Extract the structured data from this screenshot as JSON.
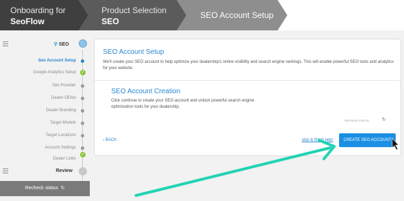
{
  "header": {
    "step1": {
      "sub": "Onboarding for",
      "main": "SeoFlow"
    },
    "step2": {
      "sub": "Product Selection",
      "main": "SEO"
    },
    "step3": {
      "title": "SEO Account Setup"
    }
  },
  "sidebar": {
    "section": "SEO",
    "items": [
      {
        "label": "Seo Account Setup",
        "state": "active"
      },
      {
        "label": "Google Analytics Setup",
        "state": "complete"
      },
      {
        "label": "Site Provider",
        "state": "pending"
      },
      {
        "label": "Dealer OEMs",
        "state": "pending"
      },
      {
        "label": "Dealer Branding",
        "state": "pending"
      },
      {
        "label": "Target Models",
        "state": "pending"
      },
      {
        "label": "Target Locations",
        "state": "pending"
      },
      {
        "label": "Account Settings",
        "state": "pending"
      },
      {
        "label": "Dealer Links",
        "state": "complete"
      }
    ],
    "review_label": "Review",
    "recheck_label": "Recheck status"
  },
  "card": {
    "title": "SEO Account Setup",
    "description": "We'll create your SEO account to help optimize your dealership's online visibility and search engine rankings. This will enable powerful SEO tools and analytics for your website.",
    "sub_title": "SEO Account Creation",
    "sub_description": "Click continue to create your SEO account and unlock powerful search engine optimization tools for your dealership.",
    "refresh_label": "REFRESH STATUS",
    "back_label": "BACK",
    "skip_label": "skip & finish later",
    "create_label": "CREATE SEO ACCOUNT"
  },
  "colors": {
    "accent": "#2a86cf",
    "button": "#1a8fe3",
    "complete": "#8cc63f",
    "annotation_arrow": "#22d3b4"
  },
  "icons": {
    "menu": "hamburger-icon",
    "check": "checkmark-icon",
    "refresh": "refresh-icon",
    "back": "chevron-left-icon",
    "cursor": "mouse-pointer-icon"
  }
}
